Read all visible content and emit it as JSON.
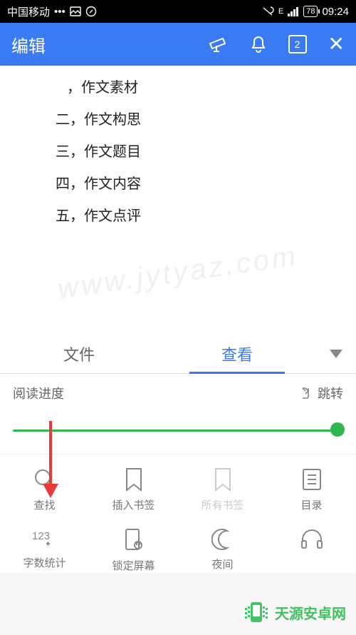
{
  "status": {
    "carrier": "中国移动",
    "dots": "•••",
    "battery": "78",
    "time": "09:24",
    "net": "E"
  },
  "toolbar": {
    "title": "编辑",
    "page_count": "2"
  },
  "content": {
    "lines": [
      "，作文素材",
      "二，作文构思",
      "三，作文题目",
      "四，作文内容",
      "五，作文点评"
    ]
  },
  "tabs": {
    "file": "文件",
    "view": "查看"
  },
  "progress": {
    "label": "阅读进度",
    "jump": "跳转",
    "value": 100
  },
  "grid": {
    "row1": [
      {
        "label": "查找",
        "icon": "search"
      },
      {
        "label": "插入书签",
        "icon": "bookmark"
      },
      {
        "label": "所有书签",
        "icon": "bookmark-dim"
      },
      {
        "label": "目录",
        "icon": "toc"
      }
    ],
    "row2": [
      {
        "label": "字数统计",
        "icon": "count"
      },
      {
        "label": "锁定屏幕",
        "icon": "lock"
      },
      {
        "label": "夜间",
        "icon": "moon"
      },
      {
        "label": "",
        "icon": "headphone"
      }
    ]
  },
  "brand": "天源安卓网",
  "watermark": "www.jytyaz.com"
}
